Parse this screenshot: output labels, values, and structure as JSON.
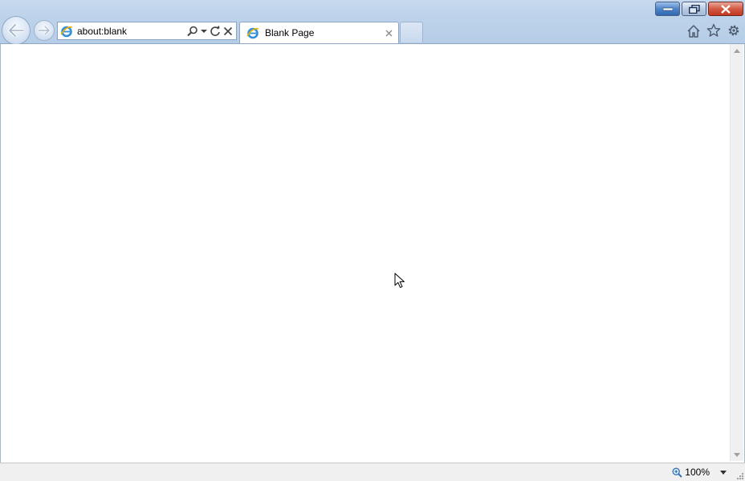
{
  "window": {
    "controls": [
      "minimize",
      "restore",
      "close"
    ]
  },
  "nav": {
    "back_icon": "back-arrow-icon",
    "forward_icon": "forward-arrow-icon"
  },
  "address": {
    "url": "about:blank"
  },
  "tabs": [
    {
      "label": "Blank Page",
      "active": true
    }
  ],
  "status": {
    "zoom": "100%"
  },
  "colors": {
    "chrome": "#bcd2ea",
    "close": "#c0391f",
    "accent_blue": "#2f68b3"
  }
}
